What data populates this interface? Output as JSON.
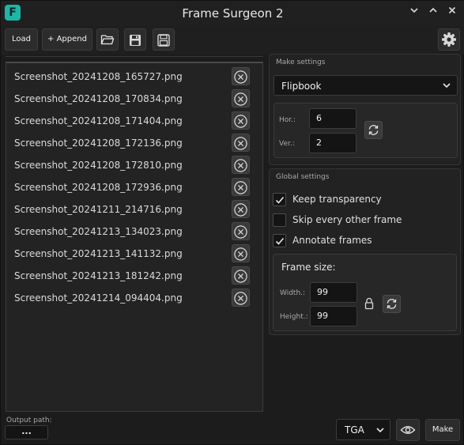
{
  "window": {
    "title": "Frame Surgeon 2",
    "logo_letter": "F",
    "controls": [
      "chevron-down-icon",
      "chevron-up-icon",
      "close-icon"
    ]
  },
  "toolbar": {
    "load_label": "Load",
    "append_label": "+ Append",
    "icons": [
      "folder-open-icon",
      "save-icon",
      "save-as-icon",
      "gear-icon"
    ]
  },
  "files": [
    "Screenshot_20241208_165727.png",
    "Screenshot_20241208_170834.png",
    "Screenshot_20241208_171404.png",
    "Screenshot_20241208_172136.png",
    "Screenshot_20241208_172810.png",
    "Screenshot_20241208_172936.png",
    "Screenshot_20241211_214716.png",
    "Screenshot_20241213_134023.png",
    "Screenshot_20241213_141132.png",
    "Screenshot_20241213_181242.png",
    "Screenshot_20241214_094404.png"
  ],
  "make_settings": {
    "title": "Make settings",
    "mode": "Flipbook",
    "hor_label": "Hor.:",
    "hor_value": "6",
    "ver_label": "Ver.:",
    "ver_value": "2"
  },
  "global_settings": {
    "title": "Global settings",
    "options": [
      {
        "label": "Keep transparency",
        "checked": true
      },
      {
        "label": "Skip every other frame",
        "checked": false
      },
      {
        "label": "Annotate frames",
        "checked": true
      }
    ],
    "frame_size": {
      "title": "Frame size:",
      "width_label": "Width.:",
      "width_value": "99",
      "height_label": "Height.:",
      "height_value": "99"
    }
  },
  "footer": {
    "output_path_label": "Output path:",
    "output_path_button": "...",
    "format": "TGA",
    "make_label": "Make"
  },
  "colors": {
    "accent": "#1fb5a7",
    "background": "#1c1c1c",
    "panel": "#232323"
  }
}
